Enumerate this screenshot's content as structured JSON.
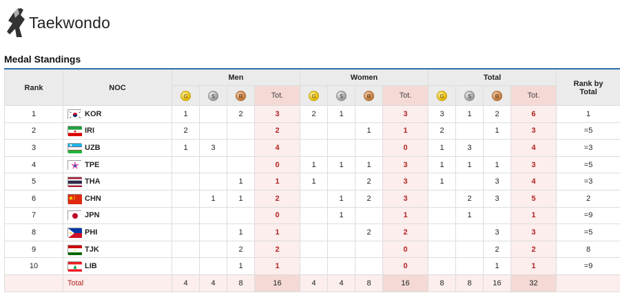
{
  "header": {
    "title": "Taekwondo",
    "icon": "taekwondo-kick-icon"
  },
  "section_title": "Medal Standings",
  "columns": {
    "rank": "Rank",
    "noc": "NOC",
    "men": "Men",
    "women": "Women",
    "total": "Total",
    "rank_by_total": "Rank by Total",
    "tot": "Tot.",
    "gold_icon": "G",
    "silver_icon": "S",
    "bronze_icon": "B"
  },
  "colors": {
    "accent_rule": "#2f6fad",
    "tot_text": "#b22222",
    "tot_cell_bg": "#fbeeec",
    "header_bg": "#ebebeb"
  },
  "rows": [
    {
      "rank": "1",
      "noc": "KOR",
      "flag": "south-korea-flag-icon",
      "men": [
        "1",
        "",
        "2",
        "3"
      ],
      "women": [
        "2",
        "1",
        "",
        "3"
      ],
      "total": [
        "3",
        "1",
        "2",
        "6"
      ],
      "rank_total": "1"
    },
    {
      "rank": "2",
      "noc": "IRI",
      "flag": "iran-flag-icon",
      "men": [
        "2",
        "",
        "",
        "2"
      ],
      "women": [
        "",
        "",
        "1",
        "1"
      ],
      "total": [
        "2",
        "",
        "1",
        "3"
      ],
      "rank_total": "=5"
    },
    {
      "rank": "3",
      "noc": "UZB",
      "flag": "uzbekistan-flag-icon",
      "men": [
        "1",
        "3",
        "",
        "4"
      ],
      "women": [
        "",
        "",
        "",
        "0"
      ],
      "total": [
        "1",
        "3",
        "",
        "4"
      ],
      "rank_total": "=3"
    },
    {
      "rank": "4",
      "noc": "TPE",
      "flag": "chinese-taipei-flag-icon",
      "men": [
        "",
        "",
        "",
        "0"
      ],
      "women": [
        "1",
        "1",
        "1",
        "3"
      ],
      "total": [
        "1",
        "1",
        "1",
        "3"
      ],
      "rank_total": "=5"
    },
    {
      "rank": "5",
      "noc": "THA",
      "flag": "thailand-flag-icon",
      "men": [
        "",
        "",
        "1",
        "1"
      ],
      "women": [
        "1",
        "",
        "2",
        "3"
      ],
      "total": [
        "1",
        "",
        "3",
        "4"
      ],
      "rank_total": "=3"
    },
    {
      "rank": "6",
      "noc": "CHN",
      "flag": "china-flag-icon",
      "men": [
        "",
        "1",
        "1",
        "2"
      ],
      "women": [
        "",
        "1",
        "2",
        "3"
      ],
      "total": [
        "",
        "2",
        "3",
        "5"
      ],
      "rank_total": "2"
    },
    {
      "rank": "7",
      "noc": "JPN",
      "flag": "japan-flag-icon",
      "men": [
        "",
        "",
        "",
        "0"
      ],
      "women": [
        "",
        "1",
        "",
        "1"
      ],
      "total": [
        "",
        "1",
        "",
        "1"
      ],
      "rank_total": "=9"
    },
    {
      "rank": "8",
      "noc": "PHI",
      "flag": "philippines-flag-icon",
      "men": [
        "",
        "",
        "1",
        "1"
      ],
      "women": [
        "",
        "",
        "2",
        "2"
      ],
      "total": [
        "",
        "",
        "3",
        "3"
      ],
      "rank_total": "=5"
    },
    {
      "rank": "9",
      "noc": "TJK",
      "flag": "tajikistan-flag-icon",
      "men": [
        "",
        "",
        "2",
        "2"
      ],
      "women": [
        "",
        "",
        "",
        "0"
      ],
      "total": [
        "",
        "",
        "2",
        "2"
      ],
      "rank_total": "8"
    },
    {
      "rank": "10",
      "noc": "LIB",
      "flag": "lebanon-flag-icon",
      "men": [
        "",
        "",
        "1",
        "1"
      ],
      "women": [
        "",
        "",
        "",
        "0"
      ],
      "total": [
        "",
        "",
        "1",
        "1"
      ],
      "rank_total": "=9"
    }
  ],
  "totals": {
    "label": "Total",
    "men": [
      "4",
      "4",
      "8",
      "16"
    ],
    "women": [
      "4",
      "4",
      "8",
      "16"
    ],
    "total": [
      "8",
      "8",
      "16",
      "32"
    ]
  }
}
